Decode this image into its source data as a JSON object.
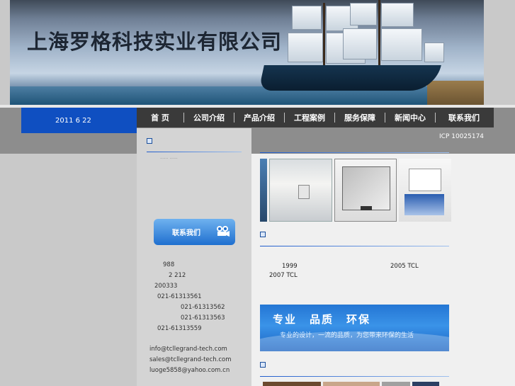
{
  "header": {
    "company_name": "上海罗格科技实业有限公司"
  },
  "datebar": {
    "date": "2011  6  22"
  },
  "nav": {
    "items": [
      {
        "label": "首    页"
      },
      {
        "label": "公司介绍"
      },
      {
        "label": "产品介绍"
      },
      {
        "label": "工程案例"
      },
      {
        "label": "服务保障"
      },
      {
        "label": "新闻中心"
      },
      {
        "label": "联系我们"
      }
    ]
  },
  "icp": "ICP  10025174",
  "left": {
    "contact_button": "联系我们",
    "fragment": "......  ......",
    "address_lines": [
      "988",
      "2  212",
      "200333"
    ],
    "phones": [
      "021-61313561",
      "021-61313562",
      "021-61313563",
      "021-61313559"
    ],
    "emails": [
      "info@tcllegrand-tech.com",
      "sales@tcllegrand-tech.com",
      "luoge5858@yahoo.com.cn"
    ]
  },
  "main": {
    "about_line1_a": "1999",
    "about_line1_b": "2005  TCL",
    "about_line2": "2007  TCL",
    "ad": {
      "words": [
        "专业",
        "品质",
        "环保"
      ],
      "slogan": "专业的设计，一流的品质，为您带来环保的生活"
    }
  },
  "colors": {
    "date_bg": "#0f4fc1",
    "nav_bg": "#3a3a3a",
    "accent": "#1f5ccc"
  },
  "icons": [
    "section-bullet-icon",
    "camera-icon"
  ]
}
